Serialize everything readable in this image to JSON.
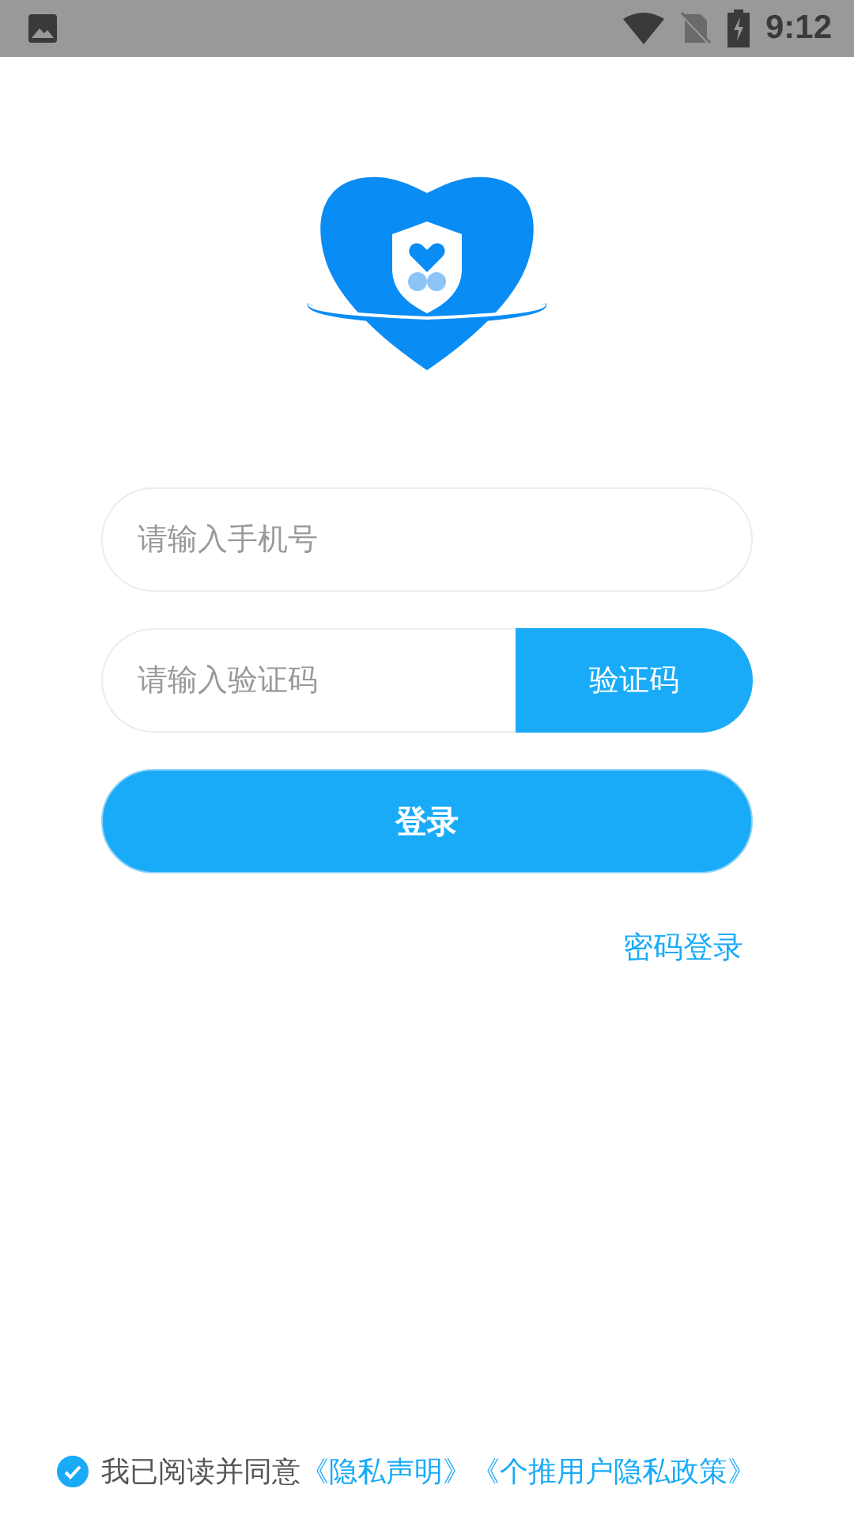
{
  "status_bar": {
    "time": "9:12"
  },
  "phone_field": {
    "placeholder": "请输入手机号"
  },
  "code_field": {
    "placeholder": "请输入验证码"
  },
  "code_button": "验证码",
  "login_button": "登录",
  "password_login_link": "密码登录",
  "agreement": {
    "checked": true,
    "text": "我已阅读并同意",
    "links": [
      "《隐私声明》",
      "《个推用户隐私政策》"
    ]
  }
}
